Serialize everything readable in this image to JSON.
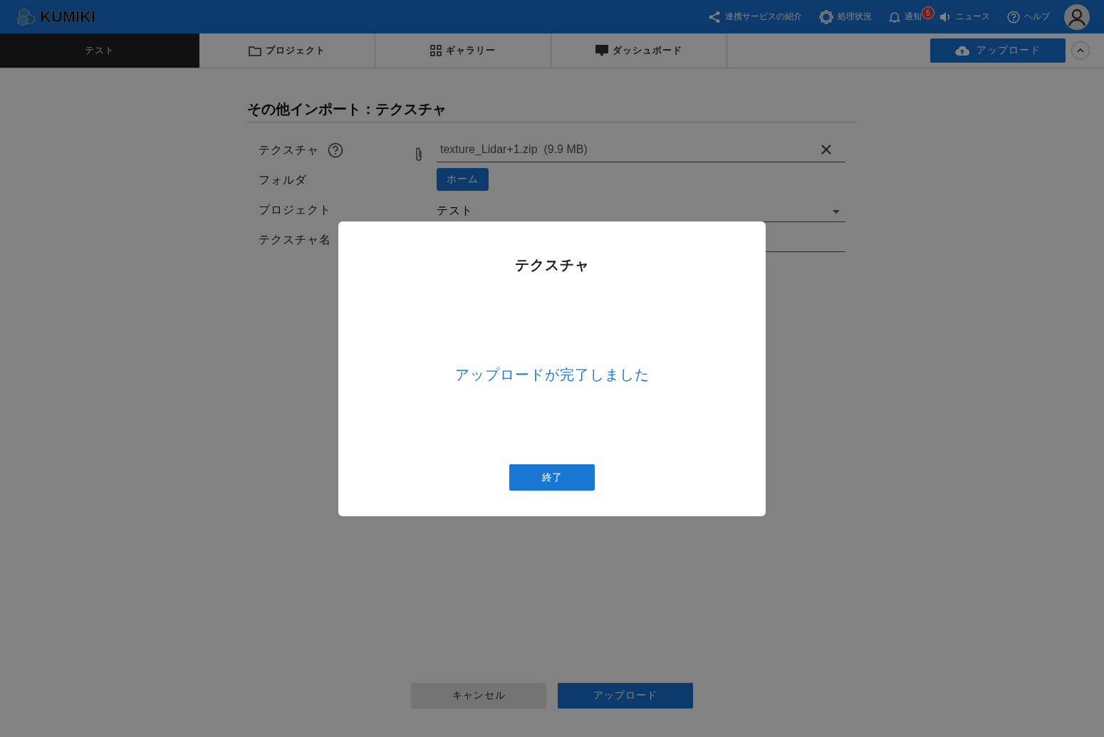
{
  "header": {
    "logo": "KUMIKI",
    "links": [
      {
        "kind": "share",
        "label": "連携サービスの紹介"
      },
      {
        "kind": "status",
        "label": "処理状況"
      },
      {
        "kind": "bell",
        "label": "通知",
        "badge": "5"
      },
      {
        "kind": "speaker",
        "label": "ニュース"
      },
      {
        "kind": "help",
        "label": "ヘルプ"
      }
    ]
  },
  "tabs": [
    {
      "label": "テスト",
      "kind": "current",
      "selected": true
    },
    {
      "label": "プロジェクト",
      "kind": "projects",
      "selected": false
    },
    {
      "label": "ギャラリー",
      "kind": "gallery",
      "selected": false
    },
    {
      "label": "ダッシュボード",
      "kind": "dashboard",
      "selected": false
    }
  ],
  "upload_button": "アップロード",
  "form": {
    "title": "その他インポート：テクスチャ",
    "rows": [
      {
        "kind": "file",
        "label": "テクスチャ",
        "help": true,
        "value": "texture_Lidar+1.zip  (9.9 MB)"
      },
      {
        "kind": "folder",
        "label": "フォルダ",
        "button": "ホーム"
      },
      {
        "kind": "project",
        "label": "プロジェクト",
        "value": "テスト"
      },
      {
        "kind": "text",
        "label": "テクスチャ名"
      }
    ]
  },
  "actions": {
    "cancel": "キャンセル",
    "submit": "アップロード"
  },
  "dialog": {
    "title": "テクスチャ",
    "message": "アップロードが完了しました",
    "button": "終了"
  }
}
